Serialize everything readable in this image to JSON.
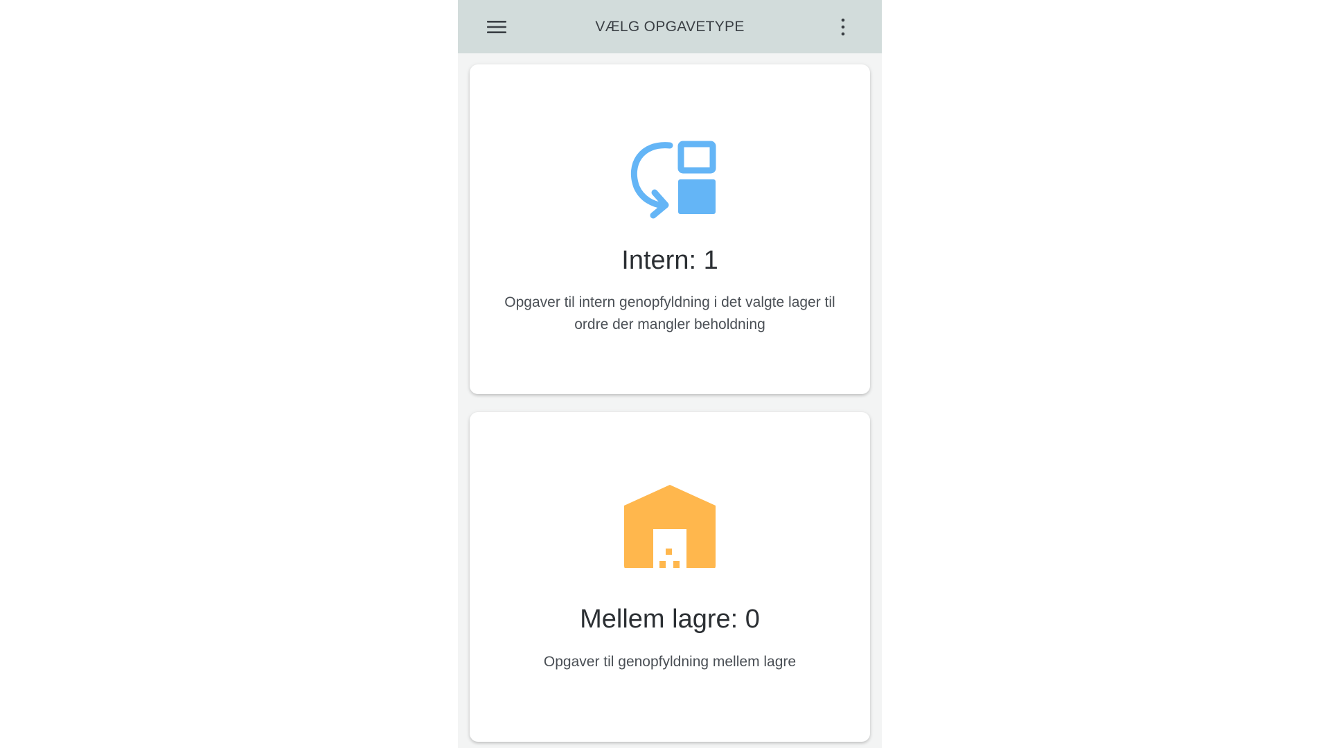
{
  "appbar": {
    "title": "VÆLG OPGAVETYPE",
    "menu_icon": "hamburger-menu-icon",
    "more_icon": "more-vert-icon"
  },
  "cards": [
    {
      "title": "Intern: 1",
      "description": "Opgaver til intern genopfyldning i det valgte lager til ordre der mangler beholdning",
      "icon": "internal-transfer-icon",
      "icon_color": "#64b5f6"
    },
    {
      "title": "Mellem lagre: 0",
      "description": "Opgaver til genopfyldning mellem lagre",
      "icon": "warehouse-icon",
      "icon_color": "#ffb74d"
    }
  ],
  "colors": {
    "appbar_bg": "#d2dcdb",
    "page_bg": "#f3f4f4",
    "card_bg": "#ffffff",
    "text_primary": "#2b2f33",
    "text_secondary": "#4a4f55"
  }
}
